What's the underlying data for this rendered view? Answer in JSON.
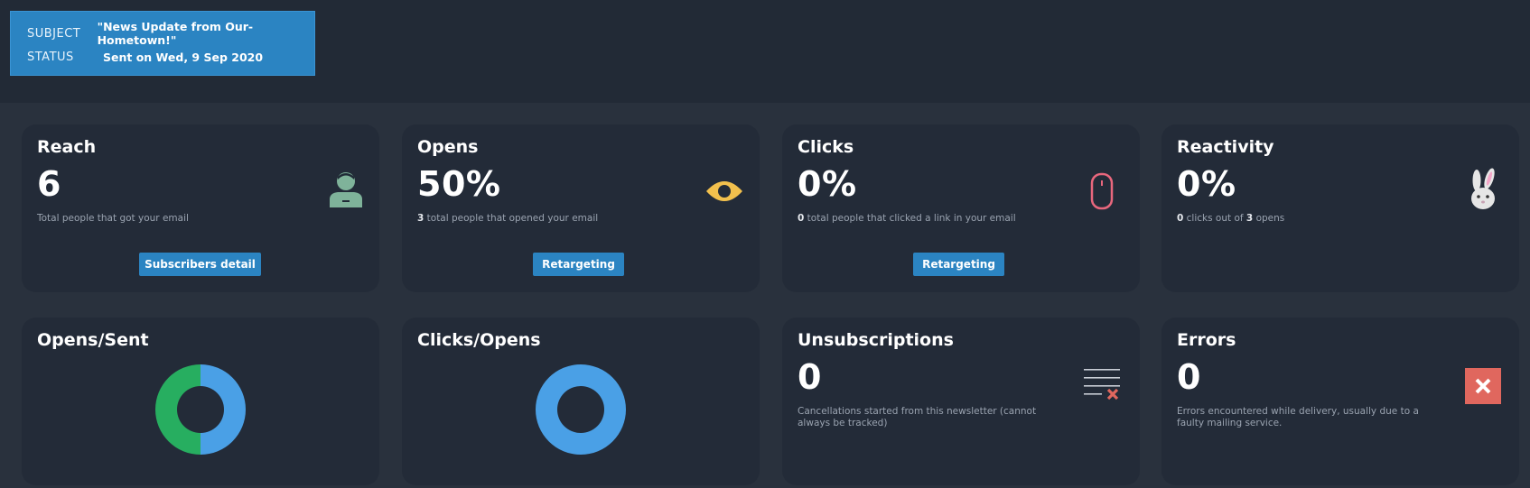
{
  "header": {
    "subject_label": "SUBJECT",
    "subject_value": "\"News Update from Our-Hometown!\"",
    "status_label": "STATUS",
    "status_value": "Sent on Wed, 9 Sep 2020"
  },
  "cards": {
    "reach": {
      "title": "Reach",
      "value": "6",
      "description": "Total people that got your email",
      "button": "Subscribers detail",
      "icon": "person-icon"
    },
    "opens": {
      "title": "Opens",
      "value": "50%",
      "count": "3",
      "description": " total people that opened your email",
      "button": "Retargeting",
      "icon": "eye-icon"
    },
    "clicks": {
      "title": "Clicks",
      "value": "0%",
      "count": "0",
      "description": " total people that clicked a link in your email",
      "button": "Retargeting",
      "icon": "mouse-icon"
    },
    "reactivity": {
      "title": "Reactivity",
      "value": "0%",
      "clicks": "0",
      "text_mid": " clicks out of ",
      "opens": "3",
      "text_end": " opens",
      "icon": "rabbit-icon"
    },
    "opens_sent": {
      "title": "Opens/Sent",
      "chart": {
        "opened": 3,
        "not_opened": 3,
        "colors": [
          "#4aa0e6",
          "#27ae60"
        ]
      }
    },
    "clicks_opens": {
      "title": "Clicks/Opens",
      "chart": {
        "clicked": 0,
        "not_clicked": 3,
        "colors": [
          "#4aa0e6"
        ]
      }
    },
    "unsubscriptions": {
      "title": "Unsubscriptions",
      "value": "0",
      "description": "Cancellations started from this newsletter (cannot always be tracked)",
      "icon": "list-remove-icon"
    },
    "errors": {
      "title": "Errors",
      "value": "0",
      "description": "Errors encountered while delivery, usually due to a faulty mailing service.",
      "icon": "close-box-icon"
    }
  },
  "colors": {
    "accent": "#2b84c2",
    "eye": "#f2c04d",
    "mouse": "#e8677d",
    "error": "#e0675e",
    "person": "#7fb39a"
  }
}
